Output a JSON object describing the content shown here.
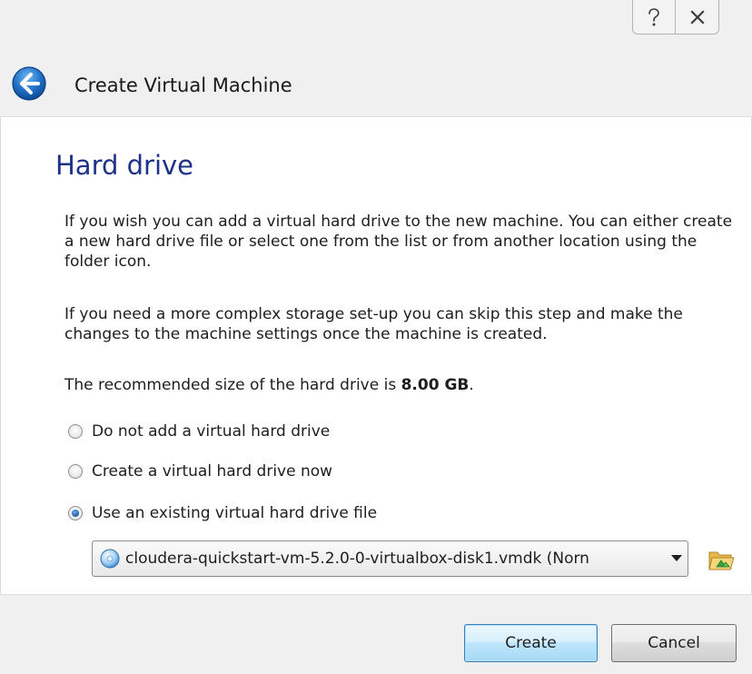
{
  "window": {
    "title": "Create Virtual Machine"
  },
  "caption_buttons": {
    "help_icon": "help-question-icon",
    "close_icon": "close-x-icon"
  },
  "page": {
    "heading": "Hard drive",
    "paragraph_1": "If you wish you can add a virtual hard drive to the new machine. You can either create a new hard drive file or select one from the list or from another location using the folder icon.",
    "paragraph_2": "If you need a more complex storage set-up you can skip this step and make the changes to the machine settings once the machine is created.",
    "recommended_prefix": "The recommended size of the hard drive is ",
    "recommended_size": "8.00 GB",
    "recommended_suffix": "."
  },
  "options": [
    {
      "label": "Do not add a virtual hard drive",
      "checked": false
    },
    {
      "label": "Create a virtual hard drive now",
      "checked": false
    },
    {
      "label": "Use an existing virtual hard drive file",
      "checked": true
    }
  ],
  "disk_select": {
    "value": "cloudera-quickstart-vm-5.2.0-0-virtualbox-disk1.vmdk (Norn",
    "icon": "hard-disk-icon"
  },
  "buttons": {
    "create": "Create",
    "cancel": "Cancel"
  },
  "colors": {
    "heading": "#1e3287",
    "accent": "#3c7fb1",
    "back_button": "#1f6fc5"
  }
}
